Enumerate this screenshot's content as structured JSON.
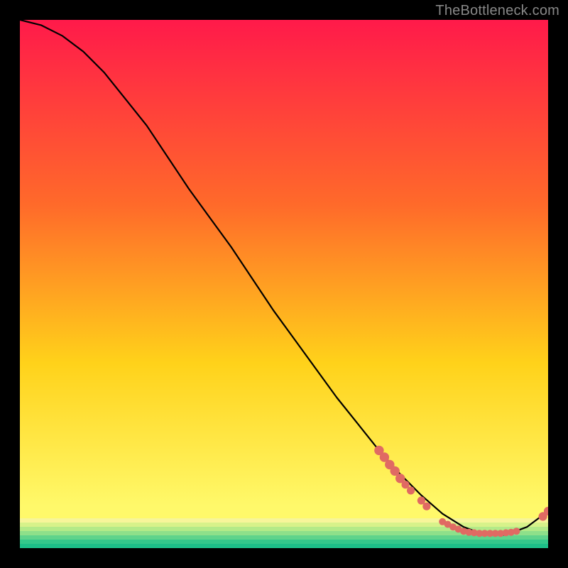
{
  "watermark": "TheBottleneck.com",
  "colors": {
    "bg": "#000000",
    "gradient_top": "#ff1a4a",
    "gradient_mid1": "#ff6a2a",
    "gradient_mid2": "#ffd21a",
    "gradient_bottom": "#fff96a",
    "stripe1": "#f7f59a",
    "stripe2": "#d7f28a",
    "stripe3": "#b3ea88",
    "stripe4": "#8ee08a",
    "stripe5": "#5fd38b",
    "stripe6": "#34c88b",
    "stripe7": "#1dbf88",
    "curve": "#000000",
    "marker": "#e06a63"
  },
  "chart_data": {
    "type": "line",
    "title": "",
    "xlabel": "",
    "ylabel": "",
    "xlim": [
      0,
      100
    ],
    "ylim": [
      0,
      100
    ],
    "series": [
      {
        "name": "curve",
        "x": [
          0,
          4,
          8,
          12,
          16,
          20,
          24,
          28,
          32,
          36,
          40,
          44,
          48,
          52,
          56,
          60,
          64,
          68,
          72,
          76,
          80,
          84,
          88,
          92,
          96,
          100
        ],
        "y": [
          100,
          99,
          97,
          94,
          90,
          85,
          80,
          74,
          68,
          62.5,
          57,
          51,
          45,
          39.5,
          34,
          28.5,
          23.5,
          18.5,
          14,
          10,
          6.5,
          4,
          2.5,
          2.5,
          4,
          7
        ]
      }
    ],
    "markers": [
      {
        "x": 68,
        "y": 18.5,
        "r": 1.2
      },
      {
        "x": 69,
        "y": 17.2,
        "r": 1.2
      },
      {
        "x": 70,
        "y": 15.8,
        "r": 1.2
      },
      {
        "x": 71,
        "y": 14.6,
        "r": 1.2
      },
      {
        "x": 72,
        "y": 13.2,
        "r": 1.2
      },
      {
        "x": 73,
        "y": 12.0,
        "r": 1.0
      },
      {
        "x": 74,
        "y": 10.9,
        "r": 1.0
      },
      {
        "x": 76,
        "y": 9.0,
        "r": 1.0
      },
      {
        "x": 77,
        "y": 7.9,
        "r": 1.0
      },
      {
        "x": 80,
        "y": 5.0,
        "r": 0.9
      },
      {
        "x": 81,
        "y": 4.5,
        "r": 0.9
      },
      {
        "x": 82,
        "y": 4.0,
        "r": 0.9
      },
      {
        "x": 83,
        "y": 3.6,
        "r": 0.9
      },
      {
        "x": 84,
        "y": 3.2,
        "r": 0.9
      },
      {
        "x": 85,
        "y": 3.0,
        "r": 0.9
      },
      {
        "x": 86,
        "y": 2.9,
        "r": 0.9
      },
      {
        "x": 87,
        "y": 2.8,
        "r": 0.9
      },
      {
        "x": 88,
        "y": 2.8,
        "r": 0.9
      },
      {
        "x": 89,
        "y": 2.8,
        "r": 0.9
      },
      {
        "x": 90,
        "y": 2.8,
        "r": 0.9
      },
      {
        "x": 91,
        "y": 2.8,
        "r": 0.9
      },
      {
        "x": 92,
        "y": 2.9,
        "r": 0.9
      },
      {
        "x": 93,
        "y": 3.0,
        "r": 0.9
      },
      {
        "x": 94,
        "y": 3.2,
        "r": 0.9
      },
      {
        "x": 99,
        "y": 6.0,
        "r": 1.1
      },
      {
        "x": 100,
        "y": 7.0,
        "r": 1.1
      }
    ]
  }
}
